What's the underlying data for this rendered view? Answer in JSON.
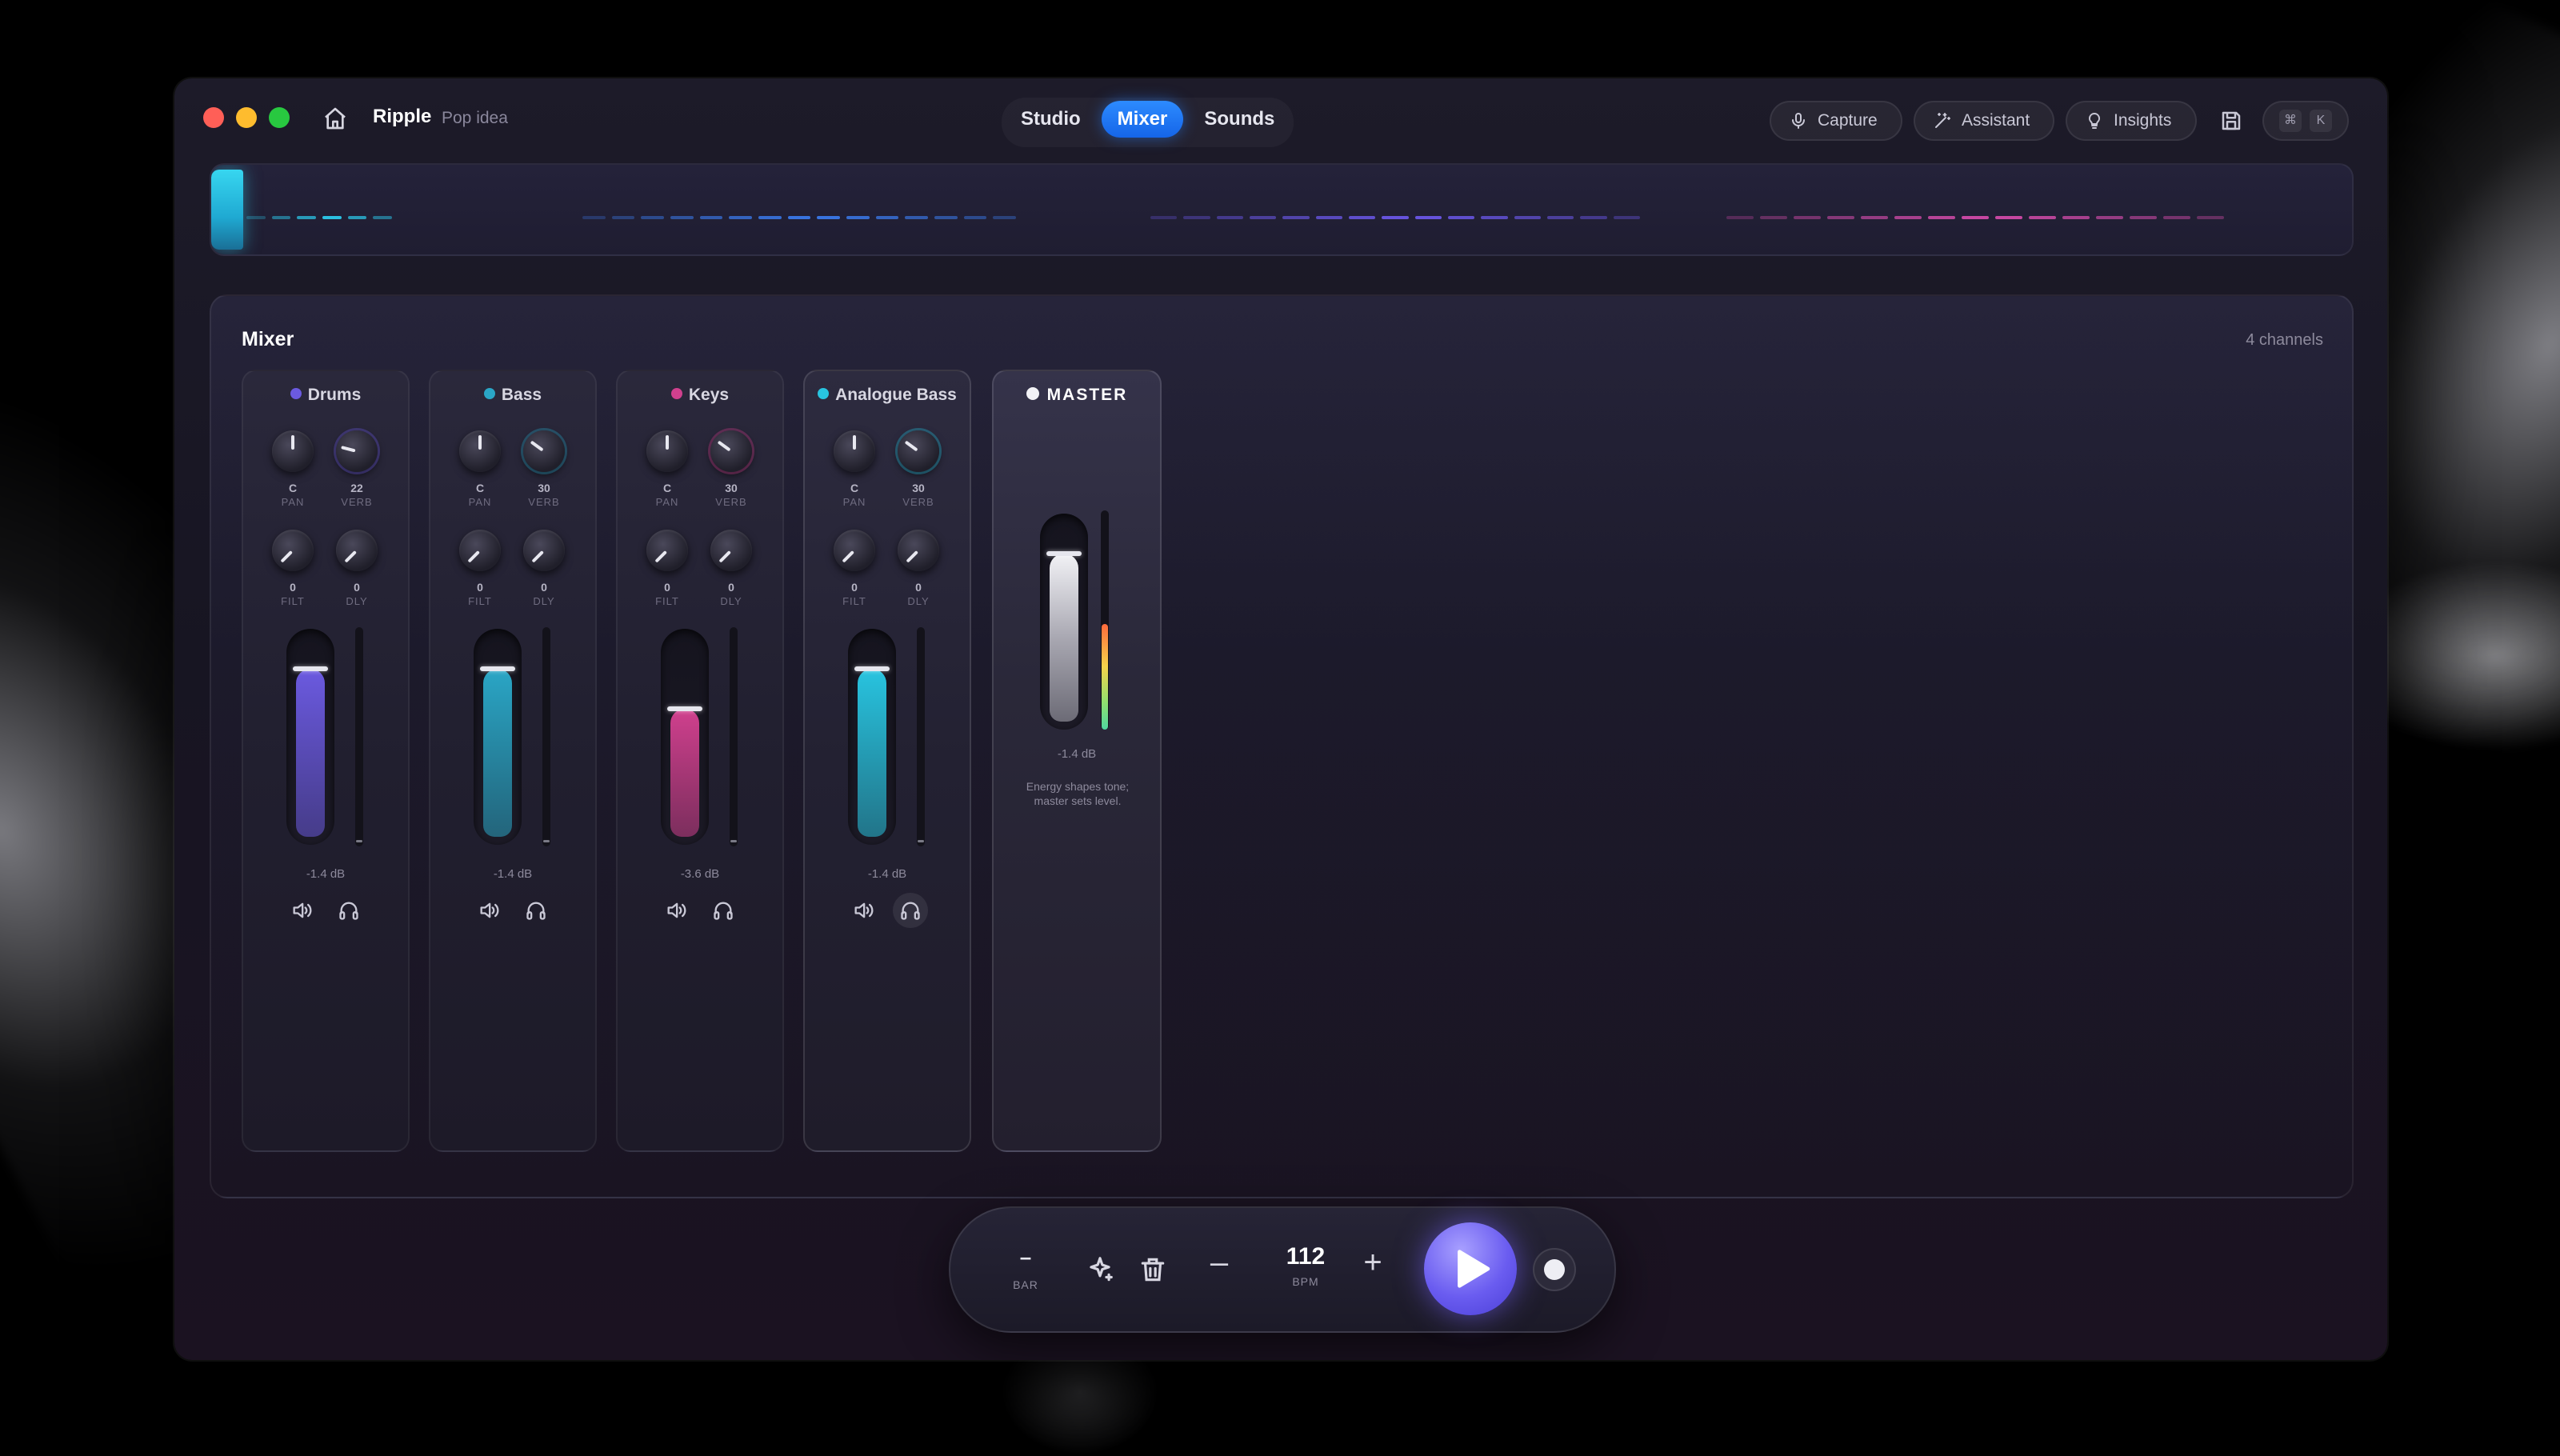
{
  "app": {
    "name": "Ripple",
    "subtitle": "Pop idea"
  },
  "tabs": [
    {
      "label": "Studio",
      "active": false
    },
    {
      "label": "Mixer",
      "active": true
    },
    {
      "label": "Sounds",
      "active": false
    }
  ],
  "toolbar": {
    "capture_label": "Capture",
    "assistant_label": "Assistant",
    "insights_label": "Insights",
    "shortcut_keys": [
      "⌘",
      "K"
    ]
  },
  "timeline": {
    "segments": [
      {
        "color": "#2bbfe0"
      },
      {
        "color": "#3a78e8"
      },
      {
        "color": "#6a56e6"
      },
      {
        "color": "#d04aa8"
      }
    ]
  },
  "mixer": {
    "title": "Mixer",
    "channel_count": "4 channels",
    "channels": [
      {
        "name": "Drums",
        "color": "#6b5ae0",
        "selected": false,
        "pan": "C",
        "pan_label": "PAN",
        "verb": "22",
        "verb_label": "VERB",
        "filt": "0",
        "filt_label": "FILT",
        "dly": "0",
        "dly_label": "DLY",
        "volume_db": "-1.4 dB",
        "fader_level": 0.84,
        "headphone_active": false
      },
      {
        "name": "Bass",
        "color": "#2aa6c6",
        "selected": false,
        "pan": "C",
        "pan_label": "PAN",
        "verb": "30",
        "verb_label": "VERB",
        "filt": "0",
        "filt_label": "FILT",
        "dly": "0",
        "dly_label": "DLY",
        "volume_db": "-1.4 dB",
        "fader_level": 0.84,
        "headphone_active": false
      },
      {
        "name": "Keys",
        "color": "#d0408e",
        "selected": false,
        "pan": "C",
        "pan_label": "PAN",
        "verb": "30",
        "verb_label": "VERB",
        "filt": "0",
        "filt_label": "FILT",
        "dly": "0",
        "dly_label": "DLY",
        "volume_db": "-3.6 dB",
        "fader_level": 0.64,
        "headphone_active": false
      },
      {
        "name": "Analogue Bass",
        "color": "#28c4e0",
        "selected": true,
        "pan": "C",
        "pan_label": "PAN",
        "verb": "30",
        "verb_label": "VERB",
        "filt": "0",
        "filt_label": "FILT",
        "dly": "0",
        "dly_label": "DLY",
        "volume_db": "-1.4 dB",
        "fader_level": 0.84,
        "headphone_active": true
      }
    ],
    "master": {
      "name": "MASTER",
      "volume_db": "-1.4 dB",
      "fader_level": 0.84,
      "note": "Energy shapes tone; master sets level."
    }
  },
  "transport": {
    "bar_value": "–",
    "bar_label": "BAR",
    "bpm_value": "112",
    "bpm_label": "BPM",
    "minus": "–",
    "plus": "+"
  },
  "colors": {
    "accent": "#1f78f0",
    "play": "#6a5cf0"
  }
}
